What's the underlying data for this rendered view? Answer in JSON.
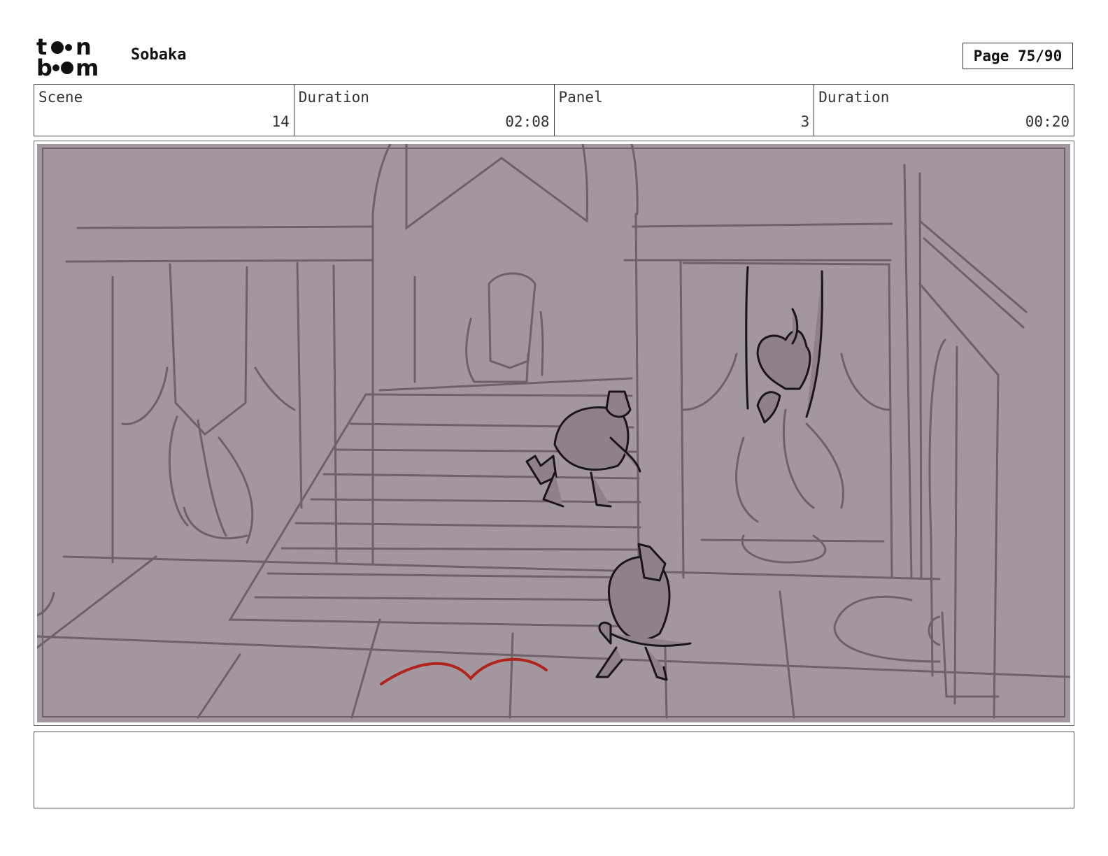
{
  "header": {
    "logo_top": "t  n",
    "logo_bottom": "b  m",
    "project_title": "Sobaka",
    "page_label": "Page",
    "page_value": "75/90"
  },
  "info": {
    "scene_label": "Scene",
    "scene_value": "14",
    "scene_duration_label": "Duration",
    "scene_duration_value": "02:08",
    "panel_label": "Panel",
    "panel_value": "3",
    "panel_duration_label": "Duration",
    "panel_duration_value": "00:20"
  },
  "colors": {
    "panel_background": "#a3979f",
    "sketch_line": "#6e6169",
    "character_line": "#1a1518",
    "accent_red": "#b0241c"
  },
  "notes": {
    "text": ""
  }
}
